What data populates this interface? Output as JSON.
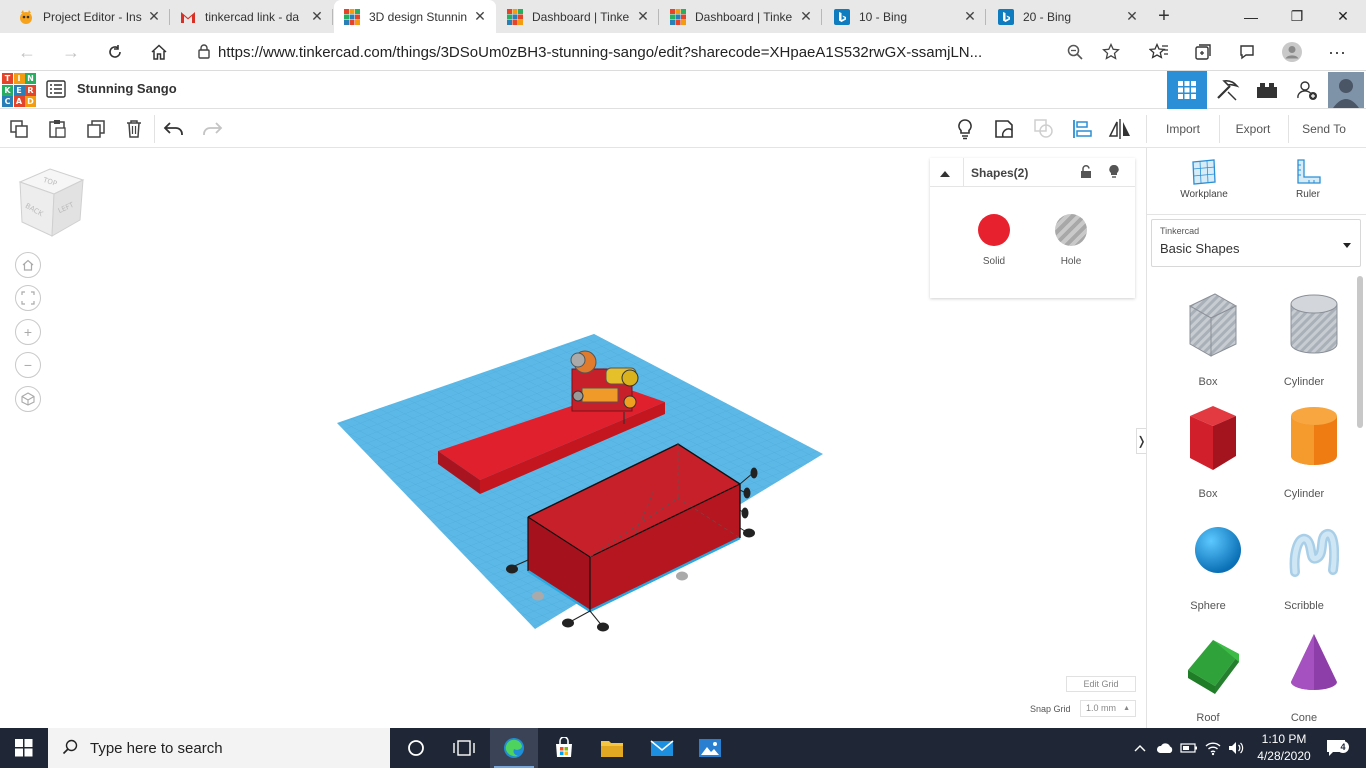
{
  "browser": {
    "tabs": [
      {
        "title": "Project Editor - Ins",
        "icon": "scratch-cat-icon"
      },
      {
        "title": "tinkercad link - da",
        "icon": "gmail-icon"
      },
      {
        "title": "3D design Stunnin",
        "icon": "tinkercad-icon",
        "active": true
      },
      {
        "title": "Dashboard | Tinke",
        "icon": "tinkercad-icon"
      },
      {
        "title": "Dashboard | Tinke",
        "icon": "tinkercad-icon"
      },
      {
        "title": "10 - Bing",
        "icon": "bing-icon"
      },
      {
        "title": "20 - Bing",
        "icon": "bing-icon"
      }
    ],
    "url": "https://www.tinkercad.com/things/3DSoUm0zBH3-stunning-sango/edit?sharecode=XHpaeA1S532rwGX-ssamjLN..."
  },
  "app": {
    "logo_letters": [
      "T",
      "I",
      "N",
      "K",
      "E",
      "R",
      "C",
      "A",
      "D"
    ],
    "design_name": "Stunning Sango",
    "toolbar": {
      "import_label": "Import",
      "export_label": "Export",
      "send_to_label": "Send To"
    },
    "view_cube": {
      "top": "TOP",
      "back": "BACK",
      "left": "LEFT"
    },
    "inspector": {
      "title": "Shapes(2)",
      "solid_label": "Solid",
      "hole_label": "Hole",
      "solid_color": "#e8212e"
    },
    "grid": {
      "edit_grid_label": "Edit Grid",
      "snap_grid_label": "Snap Grid",
      "snap_value": "1.0 mm"
    },
    "panel": {
      "workplane_label": "Workplane",
      "ruler_label": "Ruler",
      "library_source": "Tinkercad",
      "library_name": "Basic Shapes",
      "shapes": [
        {
          "label": "Box",
          "kind": "box-hole"
        },
        {
          "label": "Cylinder",
          "kind": "cylinder-hole"
        },
        {
          "label": "Box",
          "kind": "box-solid"
        },
        {
          "label": "Cylinder",
          "kind": "cylinder-solid"
        },
        {
          "label": "Sphere",
          "kind": "sphere"
        },
        {
          "label": "Scribble",
          "kind": "scribble"
        },
        {
          "label": "Roof",
          "kind": "roof"
        },
        {
          "label": "Cone",
          "kind": "cone"
        }
      ]
    }
  },
  "taskbar": {
    "search_placeholder": "Type here to search",
    "time": "1:10 PM",
    "date": "4/28/2020",
    "notification_count": "4"
  },
  "colors": {
    "accent": "#2a8fd6",
    "workplane": "#5cb8e6",
    "solid_red": "#d9202e",
    "taskbar": "#1f2736"
  }
}
